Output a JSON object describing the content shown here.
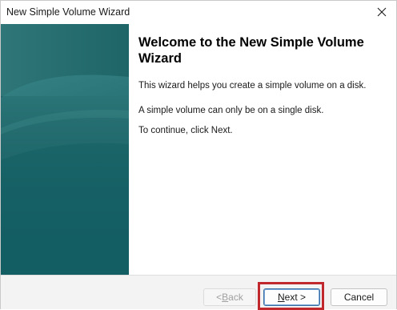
{
  "window": {
    "title": "New Simple Volume Wizard"
  },
  "content": {
    "heading": "Welcome to the New Simple Volume Wizard",
    "paragraphs": [
      "This wizard helps you create a simple volume on a disk.",
      "A simple volume can only be on a single disk.",
      "To continue, click Next."
    ]
  },
  "buttons": {
    "back": {
      "prefix": "< ",
      "accel": "B",
      "rest": "ack",
      "enabled": false
    },
    "next": {
      "accel": "N",
      "rest": "ext >",
      "enabled": true,
      "highlighted": true
    },
    "cancel": {
      "label": "Cancel",
      "enabled": true
    }
  },
  "colors": {
    "side_panel": "#1d6164",
    "highlight_border": "#c0282d",
    "default_button_border": "#3a6ea5"
  },
  "icons": {
    "close": "close-icon"
  }
}
